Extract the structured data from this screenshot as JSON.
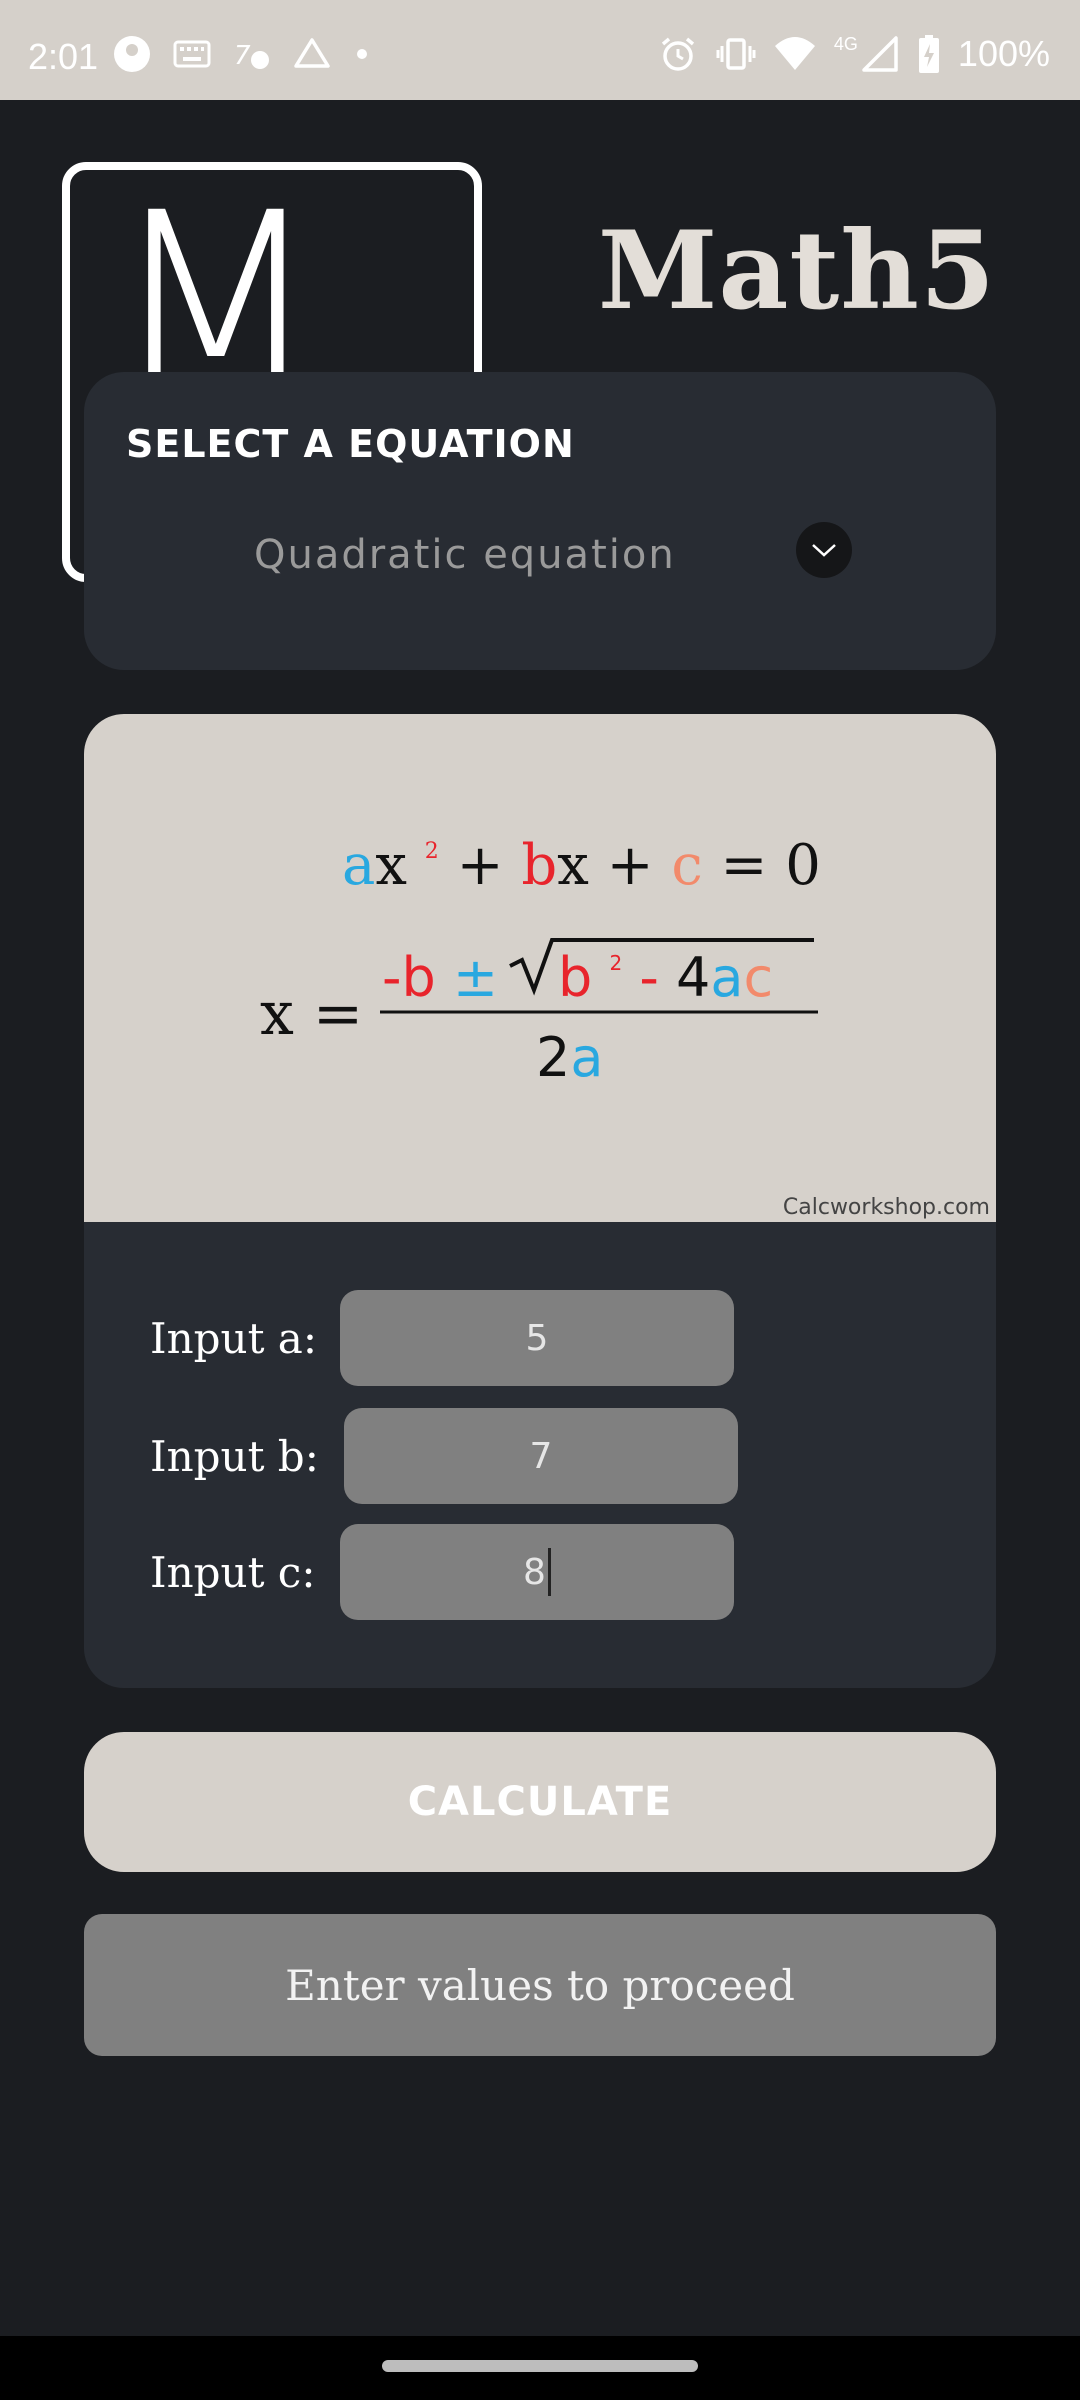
{
  "status_bar": {
    "time": "2:01",
    "battery_text": "100%",
    "network_label": "4G",
    "left_icons": [
      "app-notification-icon",
      "keyboard-icon",
      "translate-icon",
      "drive-icon",
      "dot-icon"
    ],
    "right_icons": [
      "alarm-icon",
      "vibrate-icon",
      "wifi-icon",
      "signal-icon",
      "battery-charging-icon"
    ]
  },
  "app": {
    "logo_letter": "M",
    "title": "Math5"
  },
  "equation_select": {
    "heading": "SELECT A EQUATION",
    "selected_value": "Quadratic equation"
  },
  "formula": {
    "watermark": "Calcworkshop.com"
  },
  "inputs": [
    {
      "label": "Input a:",
      "value": "5"
    },
    {
      "label": "Input b:",
      "value": "7"
    },
    {
      "label": "Input c:",
      "value": "8"
    }
  ],
  "calculate_label": "CALCULATE",
  "result_text": "Enter values to proceed",
  "colors": {
    "a_color": "#29a8e0",
    "b_color": "#e8242c",
    "c_color": "#f28a6b",
    "card": "#282c33",
    "background": "#1b1d21"
  }
}
